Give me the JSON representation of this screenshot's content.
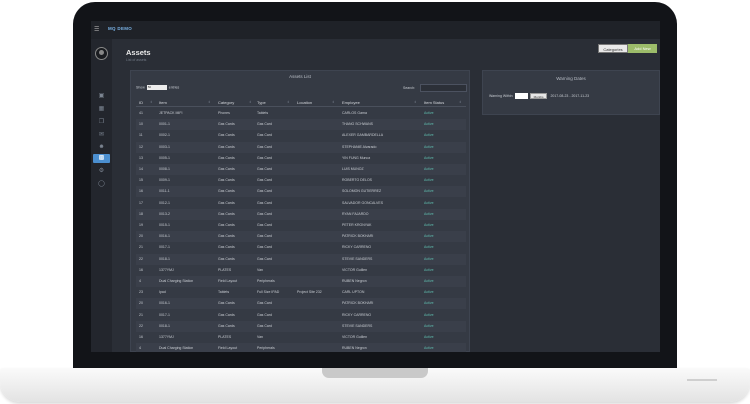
{
  "app": {
    "logo_text": "MQ DEMO"
  },
  "header": {
    "title": "Assets",
    "subtitle": "List of assets"
  },
  "buttons": {
    "categories": "Categories",
    "add_new": "Add New"
  },
  "assets_panel": {
    "title": "Assets List",
    "show_label": "Show",
    "entries_value": "50",
    "entries_label": "entries",
    "search_label": "Search:",
    "columns": [
      "ID",
      "Item",
      "Category",
      "Type",
      "Location",
      "Employee",
      "Item Status"
    ],
    "rows": [
      [
        "41",
        "JETPACK MIFI",
        "Phones",
        "Tablets",
        "",
        "CARLOS Gama",
        "Active"
      ],
      [
        "10",
        "0001-1",
        "Gas Cards",
        "Gas Card",
        "",
        "THANG SCHWANS",
        "Active"
      ],
      [
        "11",
        "0002-1",
        "Gas Cards",
        "Gas Card",
        "",
        "ALEXER GAMBARDELLA",
        "Active"
      ],
      [
        "12",
        "0003-1",
        "Gas Cards",
        "Gas Card",
        "",
        "STEPHANIE Alvarado",
        "Active"
      ],
      [
        "13",
        "0005-1",
        "Gas Cards",
        "Gas Card",
        "",
        "YIN FUNG Munoz",
        "Active"
      ],
      [
        "14",
        "0008-1",
        "Gas Cards",
        "Gas Card",
        "",
        "LUIS MUNOZ",
        "Active"
      ],
      [
        "15",
        "0009-1",
        "Gas Cards",
        "Gas Card",
        "",
        "ROBERTO DELOS",
        "Active"
      ],
      [
        "16",
        "0011-1",
        "Gas Cards",
        "Gas Card",
        "",
        "SOLOMON GUTIERREZ",
        "Active"
      ],
      [
        "17",
        "0012-1",
        "Gas Cards",
        "Gas Card",
        "",
        "SALVADOR GONCALVES",
        "Active"
      ],
      [
        "18",
        "0013-2",
        "Gas Cards",
        "Gas Card",
        "",
        "RYAN FAJARDO",
        "Active"
      ],
      [
        "19",
        "0015-1",
        "Gas Cards",
        "Gas Card",
        "",
        "PETER KRONYAK",
        "Active"
      ],
      [
        "20",
        "0016-1",
        "Gas Cards",
        "Gas Card",
        "",
        "PATRICK BOKHARI",
        "Active"
      ],
      [
        "21",
        "0017-1",
        "Gas Cards",
        "Gas Card",
        "",
        "RICKY CARRENO",
        "Active"
      ],
      [
        "22",
        "0018-1",
        "Gas Cards",
        "Gas Card",
        "",
        "STEVIE SANDERS",
        "Active"
      ],
      [
        "16",
        "1377YMJ",
        "PLATES",
        "Van",
        "",
        "VICTOR Guillen",
        "Active"
      ],
      [
        "4",
        "Dual Charging Station",
        "Field Layout",
        "Peripherals",
        "",
        "RUBEN Negron",
        "Active"
      ],
      [
        "23",
        "Ipad",
        "Tablets",
        "Full Size IPAD",
        "Project Site 232",
        "CARL UPTON",
        "Active"
      ],
      [
        "20",
        "0016-1",
        "Gas Cards",
        "Gas Card",
        "",
        "PATRICK BOKHARI",
        "Active"
      ],
      [
        "21",
        "0017-1",
        "Gas Cards",
        "Gas Card",
        "",
        "RICKY CARRENO",
        "Active"
      ],
      [
        "22",
        "0018-1",
        "Gas Cards",
        "Gas Card",
        "",
        "STEVIE SANDERS",
        "Active"
      ],
      [
        "16",
        "1377YMJ",
        "PLATES",
        "Van",
        "",
        "VICTOR Guillen",
        "Active"
      ],
      [
        "4",
        "Dual Charging Station",
        "Field Layout",
        "Peripherals",
        "",
        "RUBEN Negron",
        "Active"
      ]
    ]
  },
  "warning_panel": {
    "title": "Warning Dates",
    "warning_within_label": "Warning Within",
    "months_label": "Months",
    "date_range": "2017-08-23 - 2017-11-23"
  },
  "colors": {
    "accent": "#4b8fd0",
    "add_button": "#9cbc6a",
    "status_active": "#5fbfb0"
  }
}
